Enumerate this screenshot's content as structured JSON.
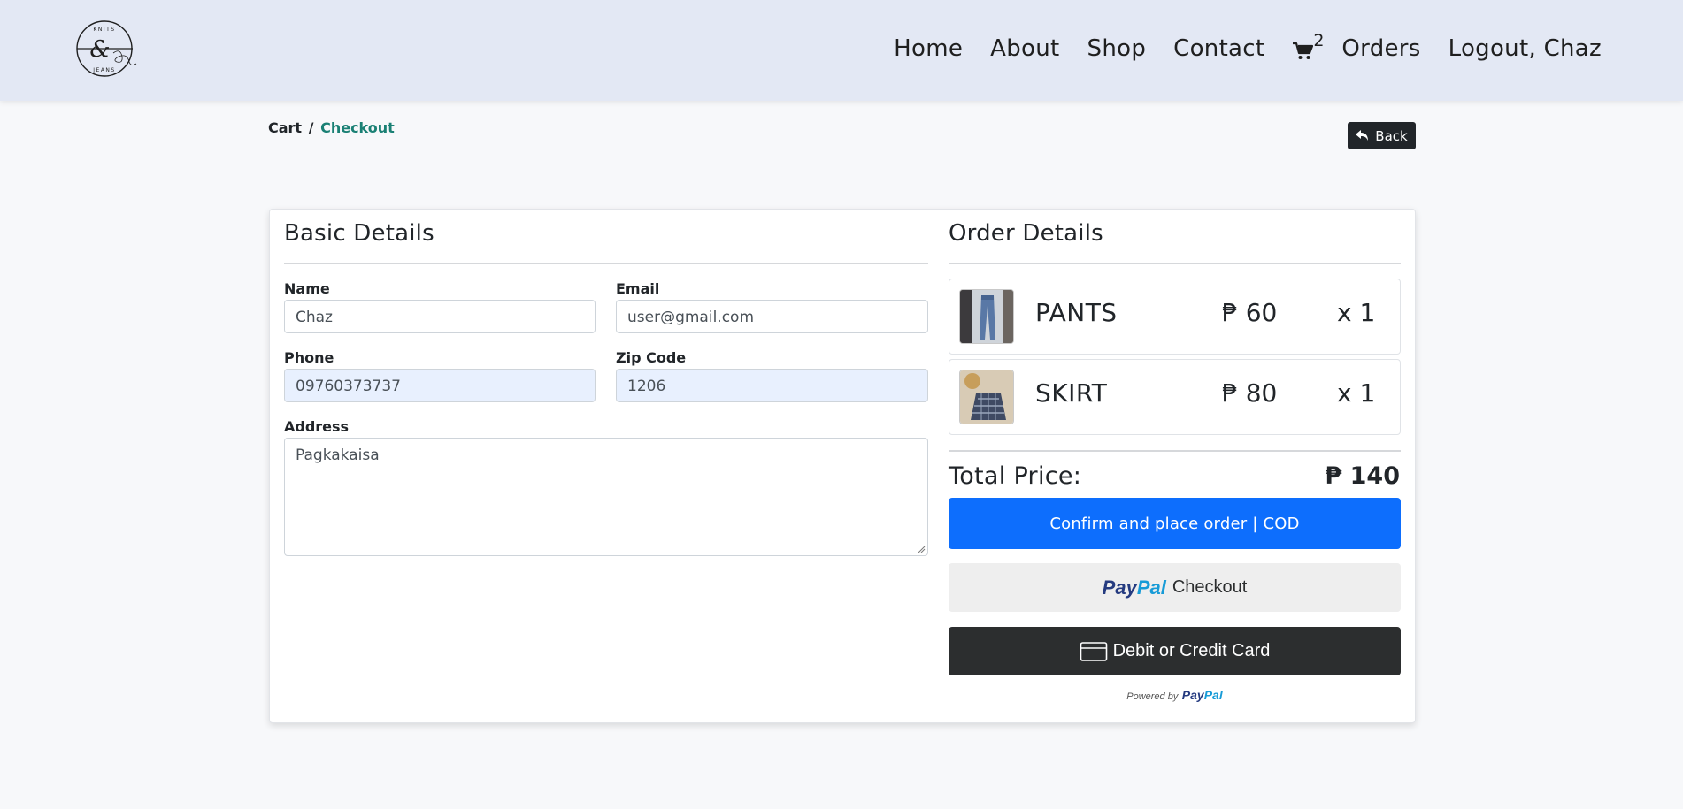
{
  "nav": {
    "logo_text_top": "KNITS",
    "logo_text_bottom": "JEANS",
    "home": "Home",
    "about": "About",
    "shop": "Shop",
    "contact": "Contact",
    "cart_count": "2",
    "orders": "Orders",
    "logout": "Logout, Chaz"
  },
  "breadcrumb": {
    "home": "Cart",
    "separator": "/",
    "active": "Checkout"
  },
  "back_button": "Back",
  "basic_details": {
    "title": "Basic Details",
    "name_label": "Name",
    "name_value": "Chaz",
    "email_label": "Email",
    "email_value": "user@gmail.com",
    "phone_label": "Phone",
    "phone_value": "09760373737",
    "zip_label": "Zip Code",
    "zip_value": "1206",
    "address_label": "Address",
    "address_value": "Pagkakaisa"
  },
  "order_details": {
    "title": "Order Details",
    "items": [
      {
        "name": "PANTS",
        "price": "₱ 60",
        "qty": "x 1"
      },
      {
        "name": "SKIRT",
        "price": "₱ 80",
        "qty": "x 1"
      }
    ],
    "total_label": "Total Price:",
    "total_value": "₱ 140"
  },
  "payment": {
    "cod_button": "Confirm and place order | COD",
    "paypal_pay": "Pay",
    "paypal_pal": "Pal",
    "paypal_checkout": "Checkout",
    "card_button": "Debit or Credit Card",
    "powered_by": "Powered by"
  },
  "colors": {
    "navbar_bg": "#e3e8f4",
    "accent_link": "#1a8074",
    "primary_button": "#0d6efd",
    "paypal_dark_blue": "#253b80",
    "paypal_light_blue": "#179bd7",
    "card_button_bg": "#2c2e2f"
  }
}
